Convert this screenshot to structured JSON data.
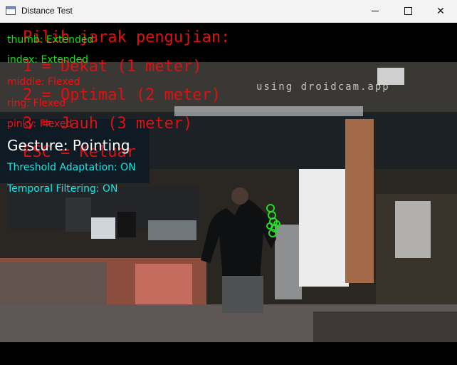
{
  "window": {
    "title": "Distance Test",
    "minimize_glyph": "—",
    "maximize_glyph": "□",
    "close_glyph": "✕"
  },
  "menu": {
    "title": "Pilih jarak pengujian:",
    "options": [
      "1 = Dekat (1 meter)",
      "2 = Optimal (2 meter)",
      "3 = Jauh (3 meter)",
      "ESC = Keluar"
    ]
  },
  "fingers": [
    {
      "text": "thumb: Extended",
      "state": "extended"
    },
    {
      "text": "index: Extended",
      "state": "extended"
    },
    {
      "text": "middle: Flexed",
      "state": "flexed"
    },
    {
      "text": "ring: Flexed",
      "state": "flexed"
    },
    {
      "text": "pinky: Flexed",
      "state": "flexed"
    }
  ],
  "gesture": "Gesture: Pointing",
  "status": [
    "Threshold Adaptation: ON",
    "Temporal Filtering: ON"
  ],
  "watermark": "using droidcam.app",
  "colors": {
    "finger_extended": "#12e012",
    "finger_flexed": "#e11111",
    "menu": "#e01010",
    "status": "#15e6e6"
  }
}
